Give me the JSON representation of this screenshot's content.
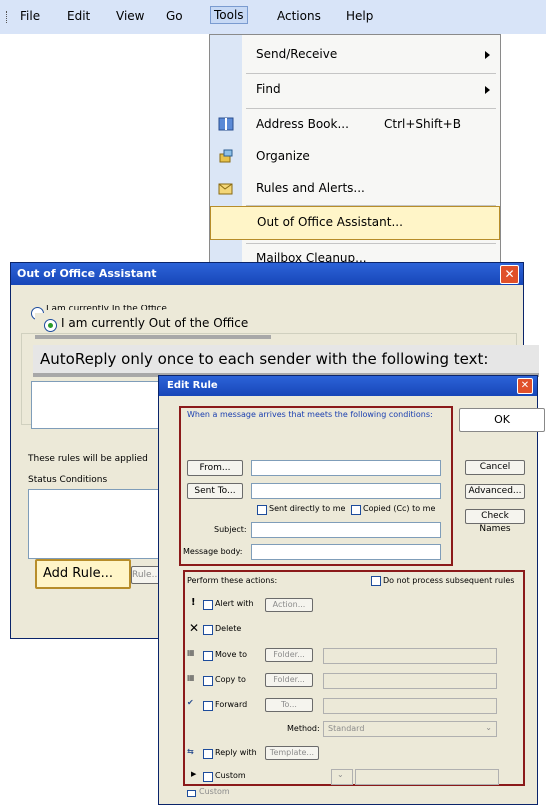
{
  "menubar": {
    "items": [
      "File",
      "Edit",
      "View",
      "Go",
      "Tools",
      "Actions",
      "Help"
    ]
  },
  "tools_menu": {
    "items": [
      {
        "label": "Send/Receive",
        "shortcut": "",
        "submenu": true
      },
      {
        "label": "Find",
        "shortcut": "",
        "submenu": true
      },
      {
        "label": "Address Book...",
        "shortcut": "Ctrl+Shift+B",
        "submenu": false
      },
      {
        "label": "Organize",
        "shortcut": "",
        "submenu": false
      },
      {
        "label": "Rules and Alerts...",
        "shortcut": "",
        "submenu": false
      },
      {
        "label": "Out of Office Assistant...",
        "shortcut": "",
        "submenu": false
      },
      {
        "label": "Mailbox Cleanup...",
        "shortcut": "",
        "submenu": false
      }
    ]
  },
  "oof_dialog": {
    "title": "Out of Office Assistant",
    "radio_in": "I am currently In the Office",
    "radio_out": "I am currently Out of the Office",
    "autoreply_label": "AutoReply only once to each sender with the following text:",
    "rules_label": "These rules will be applied",
    "columns": "Status  Conditions",
    "add_rule": "Add Rule...",
    "rule_btn": "Rule..."
  },
  "edit_rule": {
    "title": "Edit Rule",
    "conditions_header": "When a message arrives that meets the following conditions:",
    "from_btn": "From...",
    "sentto_btn": "Sent To...",
    "sent_directly": "Sent directly to me",
    "copied": "Copied (Cc) to me",
    "subject_label": "Subject:",
    "body_label": "Message body:",
    "ok": "OK",
    "cancel": "Cancel",
    "advanced": "Advanced...",
    "check_names": "Check Names",
    "actions_header": "Perform these actions:",
    "do_not_process": "Do not process subsequent rules",
    "alert_with": "Alert with",
    "action_btn": "Action...",
    "delete": "Delete",
    "move_to": "Move to",
    "copy_to": "Copy to",
    "forward": "Forward",
    "folder_btn": "Folder...",
    "to_btn": "To...",
    "method_label": "Method:",
    "method_value": "Standard",
    "reply_with": "Reply with",
    "template_btn": "Template...",
    "custom": "Custom",
    "custom2": "Custom"
  }
}
